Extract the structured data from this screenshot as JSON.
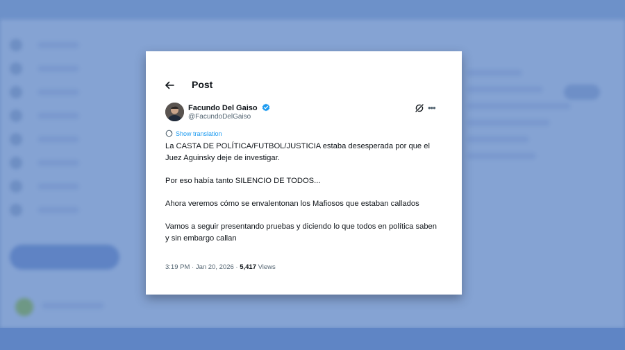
{
  "header": {
    "title": "Post"
  },
  "author": {
    "name": "Facundo Del Gaiso",
    "handle": "@FacundoDelGaiso",
    "verified": true
  },
  "translation": {
    "label": "Show translation"
  },
  "tweet": {
    "paragraphs": [
      "La CASTA DE POLÍTICA/FUTBOL/JUSTICIA estaba desesperada por que el Juez Aguinsky deje de investigar.",
      "Por eso había tanto SILENCIO DE TODOS...",
      "Ahora veremos cómo se envalentonan los Mafiosos que estaban callados",
      "Vamos a seguir presentando pruebas y diciendo lo que todos en política saben y sin embargo callan"
    ]
  },
  "meta": {
    "time": "3:19 PM · Jan 20, 2026 · ",
    "views_count": "5,417",
    "views_label": " Views"
  },
  "colors": {
    "accent": "#1d9bf0",
    "text": "#0f1419",
    "muted": "#536471",
    "background": "#6b8fc6"
  },
  "icons": [
    "back-arrow-icon",
    "verified-badge-icon",
    "grok-icon",
    "more-icon",
    "translate-icon"
  ]
}
